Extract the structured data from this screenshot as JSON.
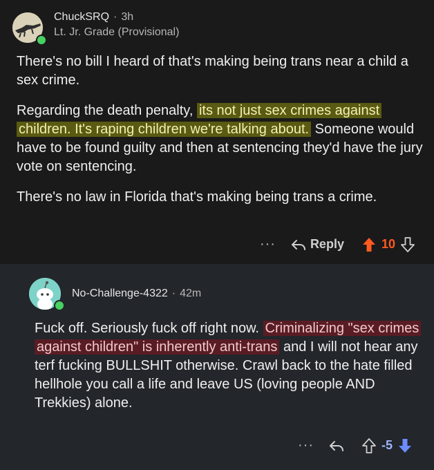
{
  "comment1": {
    "username": "ChuckSRQ",
    "separator": "·",
    "age": "3h",
    "flair": "Lt. Jr. Grade (Provisional)",
    "paragraphs": {
      "p1": "There's no bill I heard of that's making being trans near a child a sex crime.",
      "p2_before": "Regarding the death penalty, ",
      "p2_highlight": "its not just sex crimes against children. It's raping children we're talking about.",
      "p2_after": " Someone would have to be found guilty and then at sentencing they'd have the jury vote on sentencing.",
      "p3": "There's no law in Florida that's making being trans a crime."
    },
    "actions": {
      "more": "···",
      "reply_label": "Reply",
      "score": "10",
      "vote_state": "upvoted"
    }
  },
  "comment2": {
    "username": "No-Challenge-4322",
    "separator": "·",
    "age": "42m",
    "body_before": "Fuck off. Seriously fuck off right now. ",
    "body_highlight": "Criminalizing \"sex crimes against children\" is inherently anti-trans",
    "body_after": " and I will not hear any terf fucking BULLSHIT otherwise. Crawl back to the hate filled hellhole you call a life and leave US (loving people AND Trekkies) alone.",
    "actions": {
      "more": "···",
      "score": "-5",
      "vote_state": "downvoted"
    }
  },
  "colors": {
    "upvote": "#ff5a1f",
    "downvote": "#6b8dff",
    "highlight_yellow": "#5a5a12",
    "highlight_red": "#5a1c24",
    "online": "#46d160"
  }
}
